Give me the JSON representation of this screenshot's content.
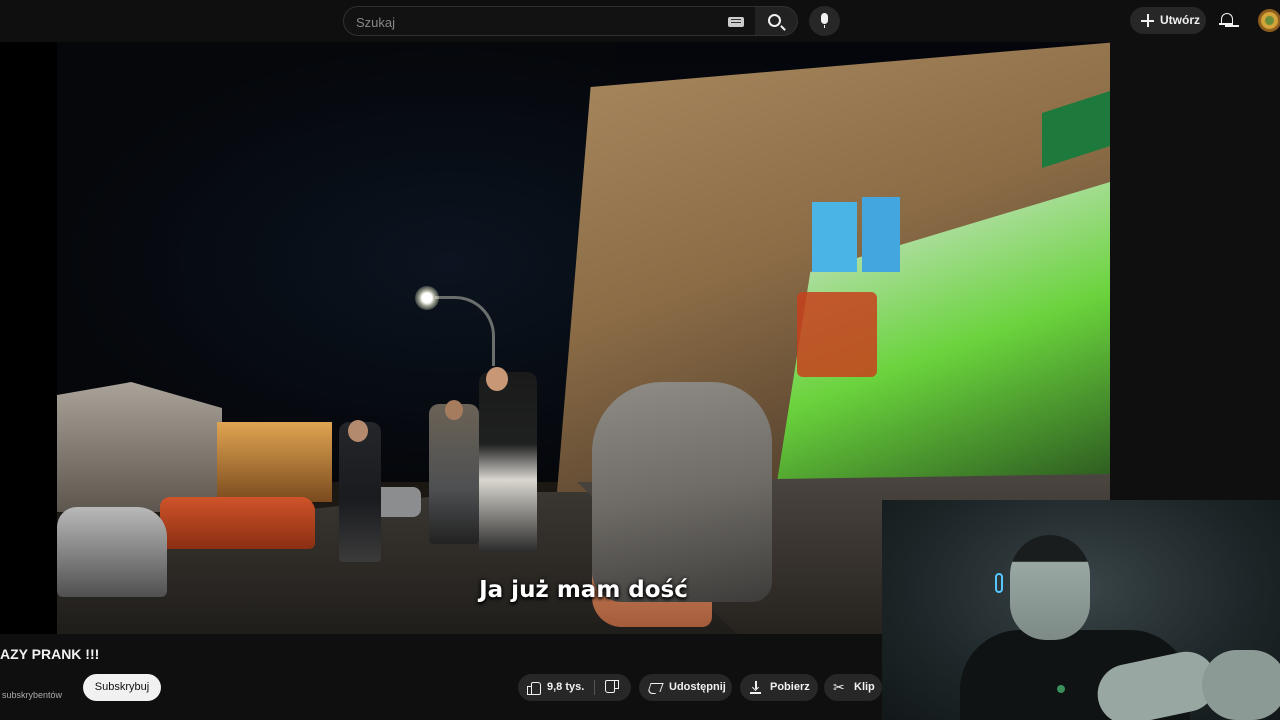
{
  "header": {
    "search_placeholder": "Szukaj",
    "create_label": "Utwórz"
  },
  "video": {
    "subtitle": "Ja już mam dość"
  },
  "below": {
    "title": "AZY PRANK !!!",
    "subscribers": "subskrybentów",
    "subscribe_label": "Subskrybuj",
    "likes": "9,8 tys.",
    "share_label": "Udostępnij",
    "download_label": "Pobierz",
    "clip_label": "Klip"
  },
  "icons": {
    "keyboard": "keyboard-icon",
    "search": "search-icon",
    "mic": "mic-icon",
    "plus": "plus-icon",
    "bell": "bell-icon",
    "like": "thumb-up-icon",
    "dislike": "thumb-down-icon",
    "share": "share-icon",
    "download": "download-icon",
    "clip": "scissors-icon"
  },
  "colors": {
    "background": "#0f0f0f",
    "pill": "#272727",
    "subscribe_bg": "#f1f1f1"
  }
}
